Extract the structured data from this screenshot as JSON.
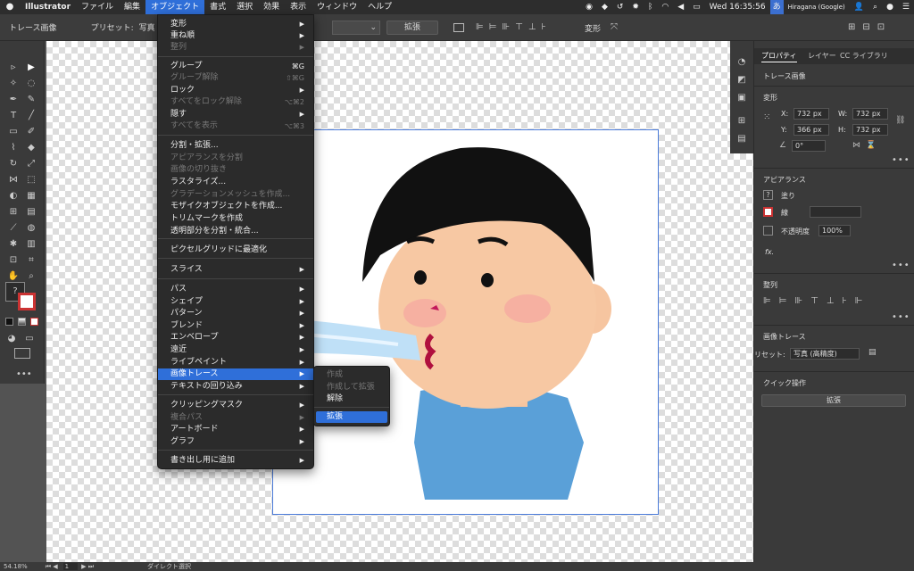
{
  "menubar": {
    "apple": "",
    "app": "Illustrator",
    "items": [
      "ファイル",
      "編集",
      "オブジェクト",
      "書式",
      "選択",
      "効果",
      "表示",
      "ウィンドウ",
      "ヘルプ"
    ],
    "active_index": 2,
    "clock": "Wed 16:35:56",
    "ime": "Hiragana (Google)"
  },
  "controlbar": {
    "mode_label": "トレース画像",
    "preset_label": "プリセット:",
    "preset_value": "写真",
    "expand_button": "拡張",
    "transform_label": "変形"
  },
  "object_menu": {
    "items": [
      {
        "label": "変形",
        "arrow": true,
        "shortcut": "",
        "disabled": false
      },
      {
        "label": "重ね順",
        "arrow": true,
        "shortcut": "",
        "disabled": false
      },
      {
        "label": "整列",
        "arrow": true,
        "shortcut": "",
        "disabled": true
      },
      {
        "label": "グループ",
        "arrow": false,
        "shortcut": "⌘G",
        "disabled": false
      },
      {
        "label": "グループ解除",
        "arrow": false,
        "shortcut": "⇧⌘G",
        "disabled": true
      },
      {
        "label": "ロック",
        "arrow": true,
        "shortcut": "",
        "disabled": false
      },
      {
        "label": "すべてをロック解除",
        "arrow": false,
        "shortcut": "⌥⌘2",
        "disabled": true
      },
      {
        "label": "隠す",
        "arrow": true,
        "shortcut": "",
        "disabled": false
      },
      {
        "label": "すべてを表示",
        "arrow": false,
        "shortcut": "⌥⌘3",
        "disabled": true
      },
      {
        "label": "分割・拡張...",
        "arrow": false,
        "shortcut": "",
        "disabled": false
      },
      {
        "label": "アピアランスを分割",
        "arrow": false,
        "shortcut": "",
        "disabled": true
      },
      {
        "label": "画像の切り抜き",
        "arrow": false,
        "shortcut": "",
        "disabled": true
      },
      {
        "label": "ラスタライズ...",
        "arrow": false,
        "shortcut": "",
        "disabled": false
      },
      {
        "label": "グラデーションメッシュを作成...",
        "arrow": false,
        "shortcut": "",
        "disabled": true
      },
      {
        "label": "モザイクオブジェクトを作成...",
        "arrow": false,
        "shortcut": "",
        "disabled": false
      },
      {
        "label": "トリムマークを作成",
        "arrow": false,
        "shortcut": "",
        "disabled": false
      },
      {
        "label": "透明部分を分割・統合...",
        "arrow": false,
        "shortcut": "",
        "disabled": false
      },
      {
        "label": "ピクセルグリッドに最適化",
        "arrow": false,
        "shortcut": "",
        "disabled": false
      },
      {
        "label": "スライス",
        "arrow": true,
        "shortcut": "",
        "disabled": false
      },
      {
        "label": "パス",
        "arrow": true,
        "shortcut": "",
        "disabled": false
      },
      {
        "label": "シェイプ",
        "arrow": true,
        "shortcut": "",
        "disabled": false
      },
      {
        "label": "パターン",
        "arrow": true,
        "shortcut": "",
        "disabled": false
      },
      {
        "label": "ブレンド",
        "arrow": true,
        "shortcut": "",
        "disabled": false
      },
      {
        "label": "エンベロープ",
        "arrow": true,
        "shortcut": "",
        "disabled": false
      },
      {
        "label": "遠近",
        "arrow": true,
        "shortcut": "",
        "disabled": false
      },
      {
        "label": "ライブペイント",
        "arrow": true,
        "shortcut": "",
        "disabled": false
      },
      {
        "label": "画像トレース",
        "arrow": true,
        "shortcut": "",
        "disabled": false,
        "highlighted": true
      },
      {
        "label": "テキストの回り込み",
        "arrow": true,
        "shortcut": "",
        "disabled": false
      },
      {
        "label": "クリッピングマスク",
        "arrow": true,
        "shortcut": "",
        "disabled": false
      },
      {
        "label": "複合パス",
        "arrow": true,
        "shortcut": "",
        "disabled": true
      },
      {
        "label": "アートボード",
        "arrow": true,
        "shortcut": "",
        "disabled": false
      },
      {
        "label": "グラフ",
        "arrow": true,
        "shortcut": "",
        "disabled": false
      },
      {
        "label": "書き出し用に追加",
        "arrow": true,
        "shortcut": "",
        "disabled": false
      }
    ]
  },
  "trace_submenu": {
    "items": [
      {
        "label": "作成",
        "disabled": true
      },
      {
        "label": "作成して拡張",
        "disabled": true
      },
      {
        "label": "解除",
        "disabled": false
      },
      {
        "label": "拡張",
        "disabled": false,
        "highlighted": true
      }
    ]
  },
  "properties_panel": {
    "tabs": [
      "プロパティ",
      "レイヤー",
      "CC ライブラリ"
    ],
    "selection": "トレース画像",
    "transform": {
      "title": "変形",
      "x_label": "X:",
      "x": "732 px",
      "y_label": "Y:",
      "y": "366 px",
      "w_label": "W:",
      "w": "732 px",
      "h_label": "H:",
      "h": "732 px",
      "angle": "0°"
    },
    "appearance": {
      "title": "アピアランス",
      "fill": "塗り",
      "stroke": "線",
      "opacity_label": "不透明度",
      "opacity": "100%",
      "fx": "fx."
    },
    "align": {
      "title": "整列"
    },
    "image_trace": {
      "title": "画像トレース",
      "preset_label": "リセット:",
      "preset_value": "写真 (高精度)"
    },
    "quick_actions": {
      "title": "クイック操作",
      "expand_button": "拡張"
    }
  },
  "statusbar": {
    "zoom": "54.18%",
    "artboard": "1",
    "tool": "ダイレクト選択"
  },
  "colors": {
    "menu_highlight": "#2f6fd9",
    "panel_bg": "#3a3a3a",
    "menu_bg": "#2b2b2b"
  }
}
